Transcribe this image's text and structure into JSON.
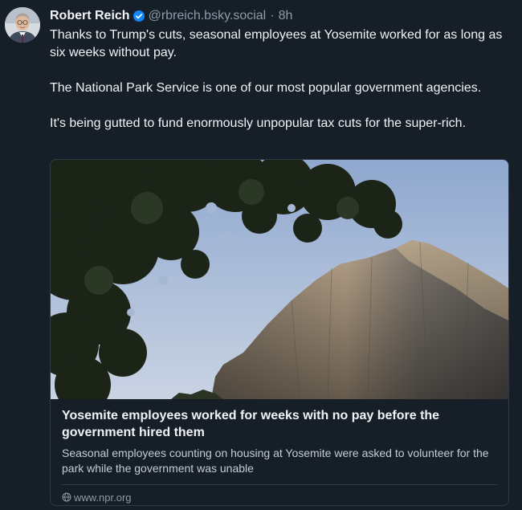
{
  "post": {
    "author_name": "Robert Reich",
    "handle": "@rbreich.bsky.social",
    "separator": "·",
    "time": "8h",
    "paragraphs": [
      "Thanks to Trump's cuts, seasonal employees at Yosemite worked for as long as six weeks without pay.",
      "The National Park Service is one of our most popular government agencies.",
      "It's being gutted to fund enormously unpopular tax cuts for the super-rich."
    ]
  },
  "link_card": {
    "title": "Yosemite employees worked for weeks with no pay before the government hired them",
    "description": "Seasonal employees counting on housing at Yosemite were asked to volunteer for the park while the government was unable",
    "domain": "www.npr.org"
  },
  "colors": {
    "background": "#161e27",
    "text_primary": "#f1f3f5",
    "text_secondary": "#8d9aa7",
    "verified_badge": "#1185fe",
    "card_border": "#2e3a47"
  },
  "icons": {
    "verified": "verified-check-icon",
    "domain": "globe-icon"
  }
}
